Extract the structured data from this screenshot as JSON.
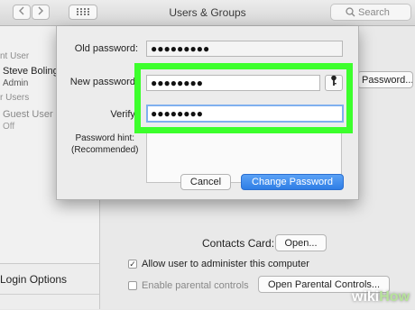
{
  "window": {
    "title": "Users & Groups"
  },
  "toolbar": {
    "search_placeholder": "Search",
    "back_icon": "chevron-left-icon",
    "forward_icon": "chevron-right-icon",
    "grid_icon": "grid-icon"
  },
  "sidebar": {
    "current_user_heading": "nt User",
    "current_user": {
      "name": "Steve Boling",
      "role": "Admin"
    },
    "other_users_heading": "r Users",
    "guest_user": {
      "name": "Guest User",
      "role": "Off"
    },
    "login_options": "Login Options"
  },
  "main": {
    "reset_password_button": "Password...",
    "contacts_card_label": "Contacts Card:",
    "open_button": "Open...",
    "allow_admin_label": "Allow user to administer this computer",
    "allow_admin_checked": true,
    "parental_controls_label": "Enable parental controls",
    "parental_controls_checked": false,
    "open_parental_controls_button": "Open Parental Controls..."
  },
  "dialog": {
    "old_password_label": "Old password:",
    "old_password_value": "●●●●●●●●●",
    "new_password_label": "New password:",
    "new_password_value": "●●●●●●●●",
    "verify_label": "Verify:",
    "verify_value": "●●●●●●●●",
    "hint_label_line1": "Password hint:",
    "hint_label_line2": "(Recommended)",
    "hint_value": "",
    "cancel_button": "Cancel",
    "change_button": "Change Password",
    "key_icon": "key-icon"
  },
  "colors": {
    "highlight": "#3cff2c",
    "accent": "#2f7ee6",
    "focus_ring": "#7fb0ef"
  },
  "watermark": {
    "wiki": "wiki",
    "how": "How"
  }
}
